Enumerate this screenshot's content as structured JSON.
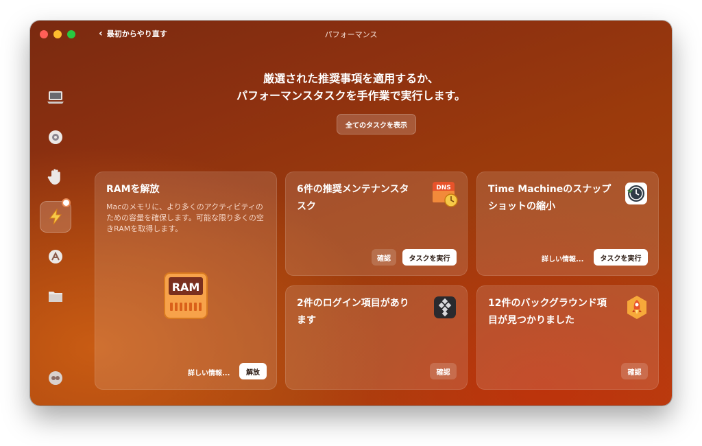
{
  "window": {
    "title": "パフォーマンス",
    "back_label": "最初からやり直す"
  },
  "hero": {
    "line1": "厳選された推奨事項を適用するか、",
    "line2": "パフォーマンスタスクを手作業で実行します。",
    "show_all": "全てのタスクを表示"
  },
  "sidebar": {
    "items": [
      {
        "icon": "monitor-icon"
      },
      {
        "icon": "shield-icon"
      },
      {
        "icon": "hand-icon"
      },
      {
        "icon": "lightning-icon",
        "active": true
      },
      {
        "icon": "apps-icon"
      },
      {
        "icon": "folder-icon"
      }
    ],
    "bottom_icon": "assistant-icon"
  },
  "cards": {
    "ram": {
      "title": "RAMを解放",
      "desc": "Macのメモリに、より多くのアクティビティのための容量を確保します。可能な限り多くの空きRAMを取得します。",
      "icon_label": "RAM",
      "more": "詳しい情報...",
      "action": "解放"
    },
    "maintenance": {
      "title_line1": "6件の推奨メンテナンスタ",
      "title_line2": "スク",
      "icon_label": "DNS",
      "review": "確認",
      "action": "タスクを実行"
    },
    "timemachine": {
      "title_line1": "Time Machineのスナップ",
      "title_line2": "ショットの縮小",
      "more": "詳しい情報...",
      "action": "タスクを実行"
    },
    "login": {
      "title_line1": "2件のログイン項目があり",
      "title_line2": "ます",
      "review": "確認"
    },
    "background": {
      "title_line1": "12件のバックグラウンド項",
      "title_line2": "目が見つかりました",
      "review": "確認"
    }
  }
}
